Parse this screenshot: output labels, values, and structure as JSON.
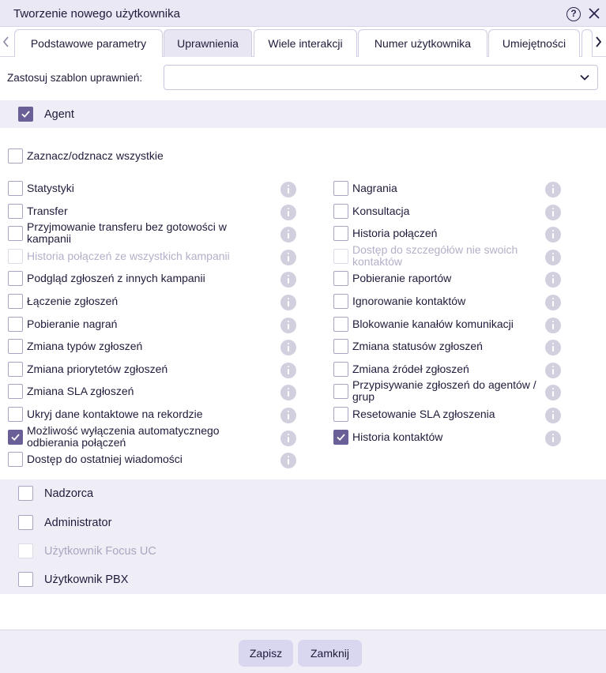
{
  "window": {
    "title": "Tworzenie nowego użytkownika"
  },
  "tabs": [
    {
      "label": "Podstawowe parametry",
      "active": false
    },
    {
      "label": "Uprawnienia",
      "active": true
    },
    {
      "label": "Wiele interakcji",
      "active": false
    },
    {
      "label": "Numer użytkownika",
      "active": false
    },
    {
      "label": "Umiejętności",
      "active": false
    }
  ],
  "template": {
    "label": "Zastosuj szablon uprawnień:",
    "value": ""
  },
  "roles": {
    "agent": {
      "label": "Agent",
      "checked": true
    },
    "nadzorca": {
      "label": "Nadzorca",
      "checked": false
    },
    "administrator": {
      "label": "Administrator",
      "checked": false
    },
    "focus_uc": {
      "label": "Użytkownik Focus UC",
      "checked": false,
      "disabled": true
    },
    "pbx": {
      "label": "Użytkownik PBX",
      "checked": false
    }
  },
  "select_all": {
    "label": "Zaznacz/odznacz wszystkie",
    "checked": false
  },
  "permissions_left": [
    {
      "label": "Statystyki",
      "checked": false,
      "disabled": false
    },
    {
      "label": "Transfer",
      "checked": false,
      "disabled": false
    },
    {
      "label": "Przyjmowanie transferu bez gotowości w kampanii",
      "checked": false,
      "disabled": false
    },
    {
      "label": "Historia połączeń ze wszystkich kampanii",
      "checked": false,
      "disabled": true
    },
    {
      "label": "Podgląd zgłoszeń z innych kampanii",
      "checked": false,
      "disabled": false
    },
    {
      "label": "Łączenie zgłoszeń",
      "checked": false,
      "disabled": false
    },
    {
      "label": "Pobieranie nagrań",
      "checked": false,
      "disabled": false
    },
    {
      "label": "Zmiana typów zgłoszeń",
      "checked": false,
      "disabled": false
    },
    {
      "label": "Zmiana priorytetów zgłoszeń",
      "checked": false,
      "disabled": false
    },
    {
      "label": "Zmiana SLA zgłoszeń",
      "checked": false,
      "disabled": false
    },
    {
      "label": "Ukryj dane kontaktowe na rekordzie",
      "checked": false,
      "disabled": false
    },
    {
      "label": "Możliwość wyłączenia automatycznego odbierania połączeń",
      "checked": true,
      "disabled": false
    },
    {
      "label": "Dostęp do ostatniej wiadomości",
      "checked": false,
      "disabled": false
    }
  ],
  "permissions_right": [
    {
      "label": "Nagrania",
      "checked": false,
      "disabled": false
    },
    {
      "label": "Konsultacja",
      "checked": false,
      "disabled": false
    },
    {
      "label": "Historia połączeń",
      "checked": false,
      "disabled": false
    },
    {
      "label": "Dostęp do szczegółów nie swoich kontaktów",
      "checked": false,
      "disabled": true
    },
    {
      "label": "Pobieranie raportów",
      "checked": false,
      "disabled": false
    },
    {
      "label": "Ignorowanie kontaktów",
      "checked": false,
      "disabled": false
    },
    {
      "label": "Blokowanie kanałów komunikacji",
      "checked": false,
      "disabled": false
    },
    {
      "label": "Zmiana statusów zgłoszeń",
      "checked": false,
      "disabled": false
    },
    {
      "label": "Zmiana źródeł zgłoszeń",
      "checked": false,
      "disabled": false
    },
    {
      "label": "Przypisywanie zgłoszeń do agentów / grup",
      "checked": false,
      "disabled": false
    },
    {
      "label": "Resetowanie SLA zgłoszenia",
      "checked": false,
      "disabled": false
    },
    {
      "label": "Historia kontaktów",
      "checked": true,
      "disabled": false
    }
  ],
  "footer": {
    "save_label": "Zapisz",
    "close_label": "Zamknij"
  },
  "icons": {
    "help": "help-icon",
    "close": "close-icon",
    "info": "info-icon",
    "chevron": "chevron-down-icon"
  },
  "colors": {
    "accent": "#6b5f97",
    "band": "#efeef7",
    "button": "#d9d6ef"
  }
}
